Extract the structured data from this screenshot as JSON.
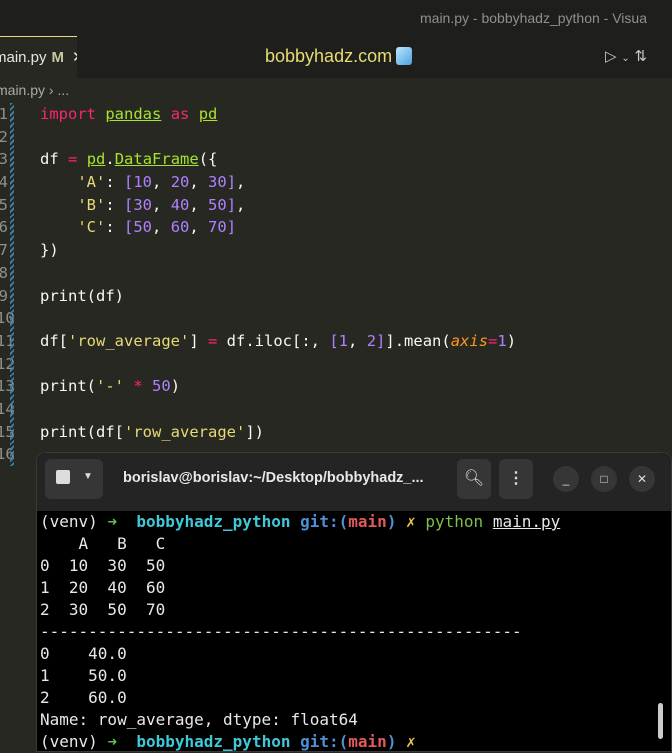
{
  "window_title": "main.py - bobbyhadz_python - Visua",
  "tab": {
    "label": "main.py",
    "modified": "M",
    "close": "✕"
  },
  "brand": "bobbyhadz.com",
  "breadcrumb": "main.py › ...",
  "code": [
    [
      [
        "import",
        "k"
      ],
      [
        " ",
        ""
      ],
      [
        "pandas",
        "g"
      ],
      [
        " ",
        ""
      ],
      [
        "as",
        "k"
      ],
      [
        " ",
        ""
      ],
      [
        "pd",
        "g"
      ]
    ],
    [],
    [
      [
        "df ",
        ""
      ],
      [
        "=",
        "p"
      ],
      [
        " ",
        ""
      ],
      [
        "pd",
        "g"
      ],
      [
        ".",
        ""
      ],
      [
        "DataFrame",
        "g"
      ],
      [
        "({",
        ""
      ]
    ],
    [
      [
        "    ",
        ""
      ],
      [
        "'A'",
        "s"
      ],
      [
        ": ",
        ""
      ],
      [
        "[",
        "b"
      ],
      [
        "10",
        "n"
      ],
      [
        ", ",
        ""
      ],
      [
        "20",
        "n"
      ],
      [
        ", ",
        ""
      ],
      [
        "30",
        "n"
      ],
      [
        "]",
        "b"
      ],
      [
        ",",
        ""
      ]
    ],
    [
      [
        "    ",
        ""
      ],
      [
        "'B'",
        "s"
      ],
      [
        ": ",
        ""
      ],
      [
        "[",
        "b"
      ],
      [
        "30",
        "n"
      ],
      [
        ", ",
        ""
      ],
      [
        "40",
        "n"
      ],
      [
        ", ",
        ""
      ],
      [
        "50",
        "n"
      ],
      [
        "]",
        "b"
      ],
      [
        ",",
        ""
      ]
    ],
    [
      [
        "    ",
        ""
      ],
      [
        "'C'",
        "s"
      ],
      [
        ": ",
        ""
      ],
      [
        "[",
        "b"
      ],
      [
        "50",
        "n"
      ],
      [
        ", ",
        ""
      ],
      [
        "60",
        "n"
      ],
      [
        ", ",
        ""
      ],
      [
        "70",
        "n"
      ],
      [
        "]",
        "b"
      ]
    ],
    [
      [
        "})",
        ""
      ]
    ],
    [],
    [
      [
        "print(df)",
        ""
      ]
    ],
    [],
    [
      [
        "df[",
        ""
      ],
      [
        "'row_average'",
        "s"
      ],
      [
        "] ",
        ""
      ],
      [
        "=",
        "p"
      ],
      [
        " df.iloc[:, ",
        ""
      ],
      [
        "[",
        "b"
      ],
      [
        "1",
        "n"
      ],
      [
        ", ",
        ""
      ],
      [
        "2",
        "n"
      ],
      [
        "]",
        "b"
      ],
      [
        "].mean(",
        ""
      ],
      [
        "axis",
        "i"
      ],
      [
        "=",
        "p"
      ],
      [
        "1",
        "n"
      ],
      [
        ")",
        ""
      ]
    ],
    [],
    [
      [
        "print(",
        ""
      ],
      [
        "'-'",
        "s"
      ],
      [
        " ",
        ""
      ],
      [
        "*",
        "p"
      ],
      [
        " ",
        ""
      ],
      [
        "50",
        "n"
      ],
      [
        ")",
        ""
      ]
    ],
    [],
    [
      [
        "print(df[",
        ""
      ],
      [
        "'row_average'",
        "s"
      ],
      [
        "])",
        ""
      ]
    ],
    []
  ],
  "terminal": {
    "title": "borislav@borislav:~/Desktop/bobbyhadz_...",
    "prompt": {
      "venv": "(venv)",
      "arrow": "➜",
      "dir": "bobbyhadz_python",
      "git": "git:(",
      "branch": "main",
      "git_close": ")",
      "dirty": "✗",
      "cmd": "python",
      "arg": "main.py"
    },
    "output": [
      "    A   B   C",
      "0  10  30  50",
      "1  20  40  60",
      "2  30  50  70",
      "--------------------------------------------------",
      "0    40.0",
      "1    50.0",
      "2    60.0",
      "Name: row_average, dtype: float64"
    ]
  }
}
